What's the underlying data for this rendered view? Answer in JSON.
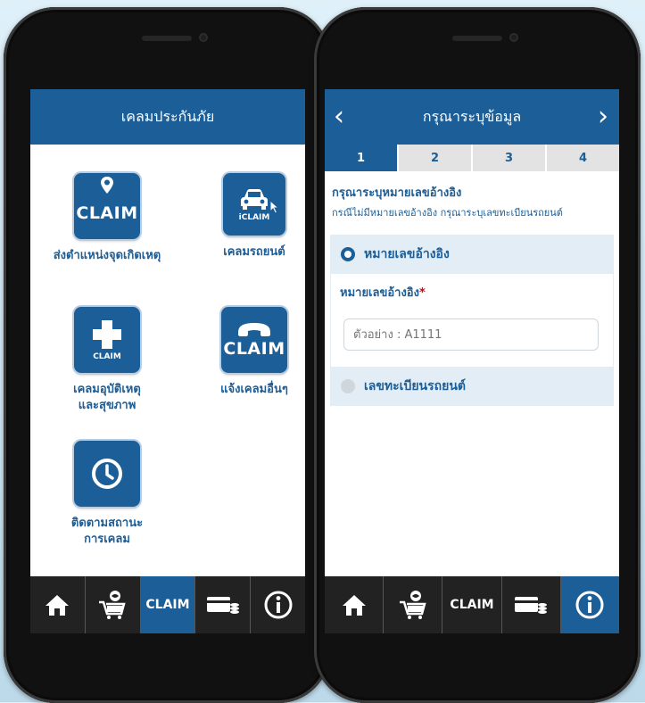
{
  "left_screen": {
    "header_title": "เคลมประกันภัย",
    "tiles": [
      {
        "icon": "map-pin-icon",
        "icon_text": "CLAIM",
        "label": "ส่งตำแหน่งจุดเกิดเหตุ"
      },
      {
        "icon": "car-icon",
        "icon_text": "iCLAIM",
        "label": "เคลมรถยนต์"
      },
      {
        "icon": "medical-cross-icon",
        "icon_text": "CLAIM",
        "label_line1": "เคลมอุบัติเหตุ",
        "label_line2": "และสุขภาพ"
      },
      {
        "icon": "phone-icon",
        "icon_text": "CLAIM",
        "label": "แจ้งเคลมอื่นๆ"
      },
      {
        "icon": "clock-icon",
        "label_line1": "ติดตามสถานะ",
        "label_line2": "การเคลม"
      }
    ],
    "bottom_tabs": [
      {
        "icon": "home-icon"
      },
      {
        "icon": "cart-icon"
      },
      {
        "label": "CLAIM",
        "active": true
      },
      {
        "icon": "card-coins-icon"
      },
      {
        "icon": "info-icon"
      }
    ]
  },
  "right_screen": {
    "header_title": "กรุณาระบุข้อมูล",
    "back_icon": "chevron-left-icon",
    "next_icon": "chevron-right-icon",
    "steps": [
      "1",
      "2",
      "3",
      "4"
    ],
    "active_step": "1",
    "form_title": "กรุณาระบุหมายเลขอ้างอิง",
    "form_subtitle": "กรณีไม่มีหมายเลขอ้างอิง กรุณาระบุเลขทะเบียนรถยนต์",
    "option_reference": "หมายเลขอ้างอิง",
    "field_label": "หมายเลขอ้างอิง",
    "field_required_mark": "*",
    "field_placeholder": "ตัวอย่าง : A1111",
    "option_plate": "เลขทะเบียนรถยนต์",
    "bottom_tabs": [
      {
        "icon": "home-icon"
      },
      {
        "icon": "cart-icon"
      },
      {
        "label": "CLAIM"
      },
      {
        "icon": "card-coins-icon"
      },
      {
        "icon": "info-icon",
        "active": true
      }
    ]
  },
  "colors": {
    "brand_blue": "#1b5e98",
    "tab_bar": "#222222",
    "step_inactive": "#e3e3e3",
    "required": "#d0021b"
  }
}
